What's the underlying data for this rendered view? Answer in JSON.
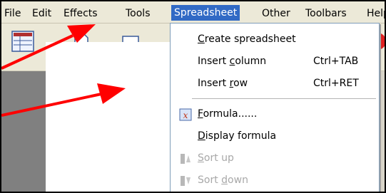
{
  "menubar": {
    "items": [
      {
        "label": "File"
      },
      {
        "label": "Edit"
      },
      {
        "label": "Effects"
      },
      {
        "label": "Tools"
      },
      {
        "label": "Spreadsheet",
        "active": true
      },
      {
        "label": "Other"
      },
      {
        "label": "Toolbars"
      },
      {
        "label": "Help"
      }
    ]
  },
  "spreadsheet_menu": {
    "create_spreadsheet": {
      "label": "Create spreadsheet",
      "mnemonic": "C"
    },
    "insert_column": {
      "label": "Insert column",
      "mnemonic": "c",
      "shortcut": "Ctrl+TAB"
    },
    "insert_row": {
      "label": "Insert row",
      "mnemonic": "r",
      "shortcut": "Ctrl+RET"
    },
    "formula": {
      "label": "Formula......",
      "mnemonic": "F",
      "icon": "formula-icon"
    },
    "display_formula": {
      "label": "Display formula",
      "mnemonic": "D"
    },
    "sort_up": {
      "label": "Sort up",
      "mnemonic": "S",
      "disabled": true,
      "icon": "sort-up-icon"
    },
    "sort_down": {
      "label": "Sort down",
      "mnemonic": "d",
      "disabled": true,
      "icon": "sort-down-icon"
    }
  },
  "colors": {
    "menu_highlight": "#316ac5",
    "annotation_arrow": "#ff0000",
    "disabled_text": "#a8a8a8"
  }
}
